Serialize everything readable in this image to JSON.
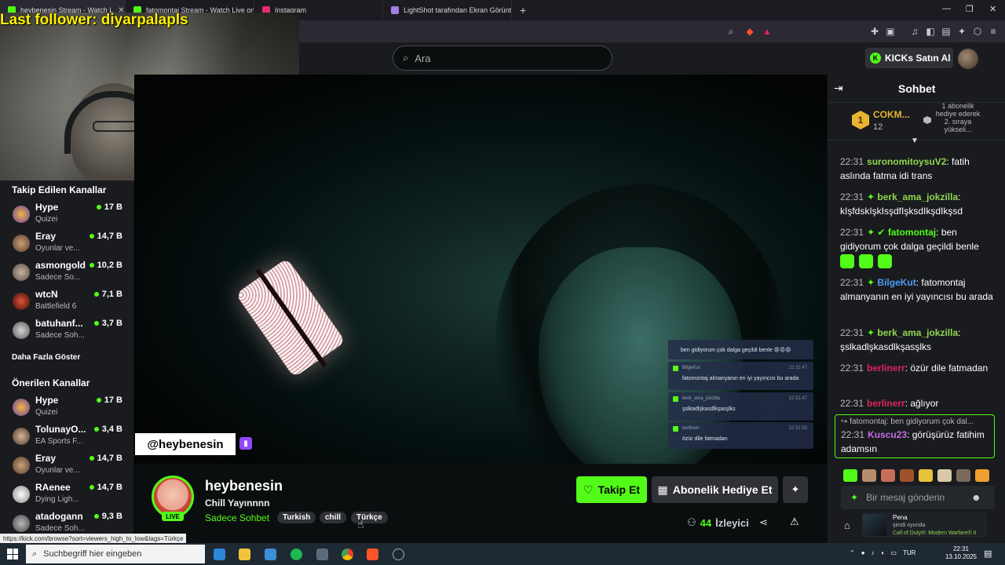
{
  "browser": {
    "tabs": [
      {
        "label": "heybenesin Stream - Watch L",
        "active": true
      },
      {
        "label": "fatomontaj Stream - Watch Live on K"
      },
      {
        "label": "Instagram"
      },
      {
        "label": "LightShot tarafından Ekran Görüntüs"
      }
    ],
    "status_url": "https://kick.com/browse?sort=viewers_high_to_low&tags=Türkçe"
  },
  "overlay": {
    "last_follower": "Last follower: diyarpalapls"
  },
  "header": {
    "search_placeholder": "Ara",
    "kicks_label": "KICKs Satın Al"
  },
  "sidebar": {
    "followed_heading": "Takip Edilen Kanallar",
    "followed": [
      {
        "name": "Hype",
        "category": "Quizei",
        "viewers": "17 B"
      },
      {
        "name": "Eray",
        "category": "Oyunlar ve...",
        "viewers": "14,7 B"
      },
      {
        "name": "asmongold",
        "category": "Sadece So...",
        "viewers": "10,2 B"
      },
      {
        "name": "wtcN",
        "category": "Battlefield 6",
        "viewers": "7,1 B"
      },
      {
        "name": "batuhanf...",
        "category": "Sadece Soh...",
        "viewers": "3,7 B"
      }
    ],
    "show_more": "Daha Fazla Göster",
    "recommended_heading": "Önerilen Kanallar",
    "recommended": [
      {
        "name": "Hype",
        "category": "Quizei",
        "viewers": "17 B"
      },
      {
        "name": "TolunayO...",
        "category": "EA Sports F...",
        "viewers": "3,4 B"
      },
      {
        "name": "Eray",
        "category": "Oyunlar ve...",
        "viewers": "14,7 B"
      },
      {
        "name": "RAenee",
        "category": "Dying Ligh...",
        "viewers": "14,7 B"
      },
      {
        "name": "atadogann",
        "category": "Sadece Soh...",
        "viewers": "9,3 B"
      }
    ]
  },
  "video": {
    "handle": "@heybenesin",
    "overlay_chat": [
      {
        "user": "",
        "time": "",
        "text": "ben gidiyorum çok dalga geçildi benle 😡😡😡"
      },
      {
        "user": "BilgeKut",
        "time": "22:31:47",
        "text": "fatomontaj almanyanın en iyi yayıncısı bu arada"
      },
      {
        "user": "berk_ama_jokzilla",
        "time": "22:31:47",
        "text": "şslkadlşkasdlkşasşlks"
      },
      {
        "user": "berlinerr",
        "time": "22:31:50",
        "text": "özür dile fatmadan"
      }
    ]
  },
  "stream": {
    "name": "heybenesin",
    "live_label": "LIVE",
    "title": "Chill Yayınnnn",
    "category": "Sadece Sohbet",
    "tags": [
      "Turkish",
      "chill",
      "Türkçe"
    ],
    "follow_label": "Takip Et",
    "gift_label": "Abonelik Hediye Et",
    "viewers_count": "44",
    "viewers_label": "İzleyici"
  },
  "chat": {
    "title": "Sohbet",
    "pinned": {
      "rank": "1",
      "user": "COKM...",
      "count": "12",
      "text": "1 abonelik hediye ederek 2. sıraya yükseli..."
    },
    "messages": [
      {
        "time": "22:31",
        "user": "suronomitoysuV2",
        "color": "#8fd64f",
        "badge": false,
        "text": ": fatih aslında fatma idi trans"
      },
      {
        "time": "22:31",
        "user": "berk_ama_jokzilla",
        "color": "#8fd64f",
        "badge": true,
        "text": ": kIşfdskIşkIsşdfIşksdIkşdIkşsd"
      },
      {
        "time": "22:31",
        "user": "fatomontaj",
        "color": "#53fc18",
        "badge": true,
        "text": ": ben gidiyorum çok dalga geçildi benle"
      },
      {
        "time": "22:31",
        "user": "BilgeKut",
        "color": "#4c9df5",
        "badge": true,
        "text": ": fatomontaj almanyanın en iyi yayıncısı bu arada"
      },
      {
        "time": "22:31",
        "user": "berk_ama_jokzilla",
        "color": "#8fd64f",
        "badge": true,
        "text": ": şslkadlşkasdlkşasşlks"
      },
      {
        "time": "22:31",
        "user": "berlinerr",
        "color": "#e0245e",
        "badge": false,
        "text": ": özür dile fatmadan"
      },
      {
        "time": "22:31",
        "user": "berlinerr",
        "color": "#e0245e",
        "badge": false,
        "text": ": ağlıyor"
      }
    ],
    "reply": {
      "context": "fatomontaj: ben gidiyorum çok dal...",
      "time": "22:31",
      "user": "Kuscu23",
      "color": "#c56be8",
      "text": ": görüşürüz fatihim adamsın"
    },
    "input_placeholder": "Bir mesaj gönderin"
  },
  "game_popup": {
    "name": "Pena",
    "status": "şimdi oyunda",
    "game": "Call of Duty®: Modern Warfare® II"
  },
  "taskbar": {
    "search_placeholder": "Suchbegriff hier eingeben",
    "lang": "TUR",
    "time": "22:31",
    "date": "13.10.2025"
  },
  "colors": {
    "kick_green": "#53fc18",
    "bg": "#0b0e0f",
    "panel": "#191b1f",
    "follower_yellow": "#fff200"
  }
}
